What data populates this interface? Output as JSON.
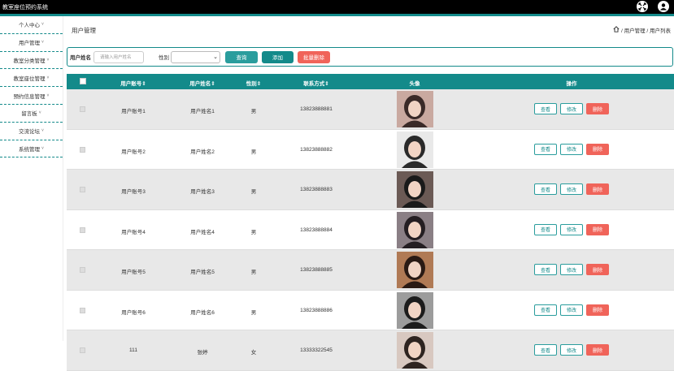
{
  "app": {
    "title": "教室座位预约系统"
  },
  "sidebar": {
    "items": [
      {
        "label": "个人中心"
      },
      {
        "label": "用户管理"
      },
      {
        "label": "教室分类管理"
      },
      {
        "label": "教室座位管理"
      },
      {
        "label": "预约信息管理"
      },
      {
        "label": "留言板"
      },
      {
        "label": "交流论坛"
      },
      {
        "label": "系统管理"
      }
    ],
    "caret": "˅"
  },
  "page": {
    "title": "用户管理",
    "breadcrumb": " / 用户管理 / 用户列表"
  },
  "search": {
    "name_label": "用户姓名",
    "name_placeholder": "请输入用户姓名",
    "gender_label": "性别",
    "gender_value": "",
    "query_btn": "查询",
    "add_btn": "添加",
    "batch_delete_btn": "批量删除"
  },
  "table": {
    "headers": {
      "account": "用户账号⇕",
      "name": "用户姓名⇕",
      "gender": "性别⇕",
      "contact": "联系方式⇕",
      "avatar": "头像",
      "ops": "操作"
    },
    "rows": [
      {
        "account": "用户账号1",
        "name": "用户姓名1",
        "gender": "男",
        "contact": "13823888881"
      },
      {
        "account": "用户账号2",
        "name": "用户姓名2",
        "gender": "男",
        "contact": "13823888882"
      },
      {
        "account": "用户账号3",
        "name": "用户姓名3",
        "gender": "男",
        "contact": "13823888883"
      },
      {
        "account": "用户账号4",
        "name": "用户姓名4",
        "gender": "男",
        "contact": "13823888884"
      },
      {
        "account": "用户账号5",
        "name": "用户姓名5",
        "gender": "男",
        "contact": "13823888885"
      },
      {
        "account": "用户账号6",
        "name": "用户姓名6",
        "gender": "男",
        "contact": "13823888886"
      },
      {
        "account": "111",
        "name": "张婷",
        "gender": "女",
        "contact": "13333322545"
      }
    ],
    "actions": {
      "view": "查看",
      "edit": "修改",
      "delete": "删除"
    }
  },
  "colors": {
    "accent": "#138a8a",
    "danger": "#f0645a",
    "row_alt": "#e8e8e8"
  }
}
